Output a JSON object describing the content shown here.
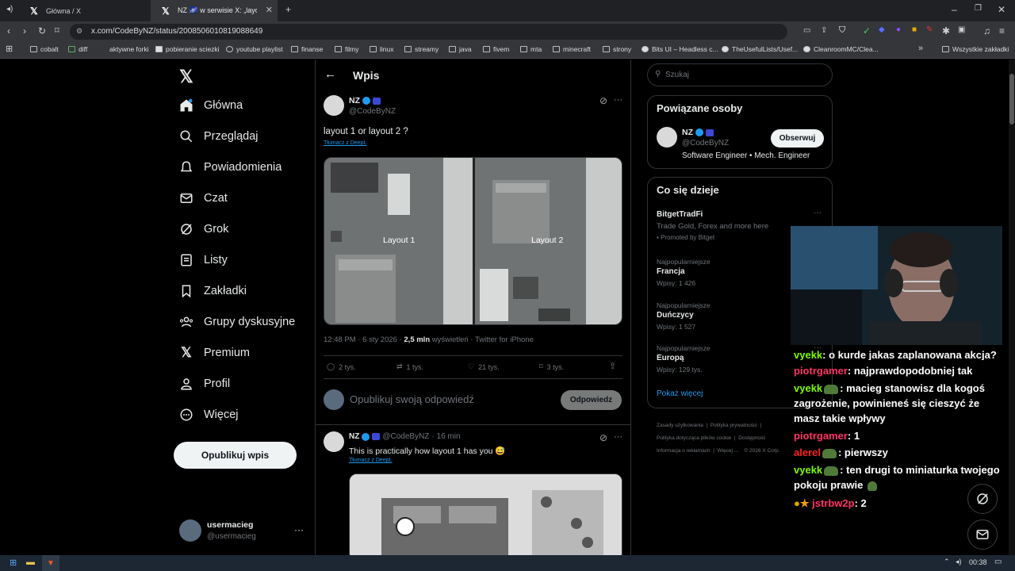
{
  "browser": {
    "tabs": [
      {
        "title": "Główna / X"
      },
      {
        "title": "NZ 🌌 w serwisie X: „layout 1 or"
      }
    ],
    "url": "x.com/CodeByNZ/status/2008506010819088649",
    "bookmarks": [
      "cobalt",
      "diff",
      "aktywne forki",
      "pobieranie sciezki",
      "youtube playlist",
      "finanse",
      "filmy",
      "linux",
      "streamy",
      "java",
      "fivem",
      "mta",
      "minecraft",
      "strony",
      "Bits UI – Headless c...",
      "TheUsefulLists/Usef...",
      "CleanroomMC/Clea..."
    ],
    "all_bookmarks": "Wszystkie zakładki"
  },
  "nav": {
    "items": [
      {
        "label": "Główna",
        "icon": "home-icon"
      },
      {
        "label": "Przeglądaj",
        "icon": "search-icon"
      },
      {
        "label": "Powiadomienia",
        "icon": "bell-icon"
      },
      {
        "label": "Czat",
        "icon": "mail-icon"
      },
      {
        "label": "Grok",
        "icon": "grok-icon"
      },
      {
        "label": "Listy",
        "icon": "list-icon"
      },
      {
        "label": "Zakładki",
        "icon": "bookmark-icon"
      },
      {
        "label": "Grupy dyskusyjne",
        "icon": "people-icon"
      },
      {
        "label": "Premium",
        "icon": "x-icon"
      },
      {
        "label": "Profil",
        "icon": "person-icon"
      },
      {
        "label": "Więcej",
        "icon": "more-icon"
      }
    ],
    "post_button": "Opublikuj wpis",
    "account": {
      "name": "usermacieg",
      "handle": "@usermacieg"
    }
  },
  "main": {
    "header_title": "Wpis",
    "post": {
      "author": "NZ",
      "handle": "@CodeByNZ",
      "text": "layout 1 or layout 2 ?",
      "translate": "Tłumacz z DeepL",
      "image_labels": [
        "Layout 1",
        "Layout 2"
      ],
      "meta_time": "12:48 PM · 6 sty 2026 · ",
      "meta_views": "2,5 mln",
      "meta_suffix": " wyświetleń · Twitter for iPhone",
      "stats": {
        "replies": "2 tys.",
        "reposts": "1 tys.",
        "likes": "21 tys.",
        "bookmarks": "3 tys."
      }
    },
    "reply_placeholder": "Opublikuj swoją odpowiedź",
    "reply_button": "Odpowiedz",
    "reply": {
      "author": "NZ",
      "handle": "@CodeByNZ",
      "time": "· 16 min",
      "text": "This is practically how layout 1 has you 😅",
      "translate": "Tłumacz z DeepL"
    }
  },
  "sidebar": {
    "search_placeholder": "Szukaj",
    "related_title": "Powiązane osoby",
    "related": {
      "name": "NZ",
      "handle": "@CodeByNZ",
      "bio": "Software Engineer • Mech. Engineer",
      "follow": "Obserwuj"
    },
    "trends_title": "Co się dzieje",
    "promo": {
      "name": "BitgetTradFi",
      "desc": "Trade Gold, Forex and more here",
      "promoted": "Promoted by Bitget"
    },
    "trends": [
      {
        "category": "Najpopularniejsze",
        "name": "Francja",
        "count": "Wpisy: 1 426"
      },
      {
        "category": "Najpopularniejsze",
        "name": "Duńczycy",
        "count": "Wpisy: 1 527"
      },
      {
        "category": "Najpopularniejsze",
        "name": "Europą",
        "count": "Wpisy: 129 tys."
      }
    ],
    "show_more": "Pokaż więcej",
    "footer": [
      "Zasady użytkowania",
      "Polityka prywatności",
      "Polityka dotycząca plików cookie",
      "Dostępność",
      "Informacja o reklamach",
      "Więcej ...",
      "© 2026 X Corp."
    ]
  },
  "chat": [
    {
      "user": "vyekk",
      "color": "#7cfc00",
      "text": ": o kurde jakas zaplanowana akcja?"
    },
    {
      "user": "piotrgamer",
      "color": "#ff3366",
      "text": ": najprawdopodobniej tak"
    },
    {
      "user": "vyekk",
      "color": "#7cfc00",
      "text": ": macieg stanowisz dla kogoś zagrożenie, powinieneś się cieszyć że masz takie wpływy"
    },
    {
      "user": "piotrgamer",
      "color": "#ff3366",
      "text": ": 1"
    },
    {
      "user": "alerel",
      "color": "#ff2020",
      "text": ": pierwszy"
    },
    {
      "user": "vyekk",
      "color": "#7cfc00",
      "text": ": ten drugi to miniaturka twojego pokoju prawie"
    },
    {
      "user": "jstrbw2p",
      "color": "#ff3366",
      "text": ": 2"
    }
  ],
  "taskbar": {
    "time": "00:38"
  }
}
